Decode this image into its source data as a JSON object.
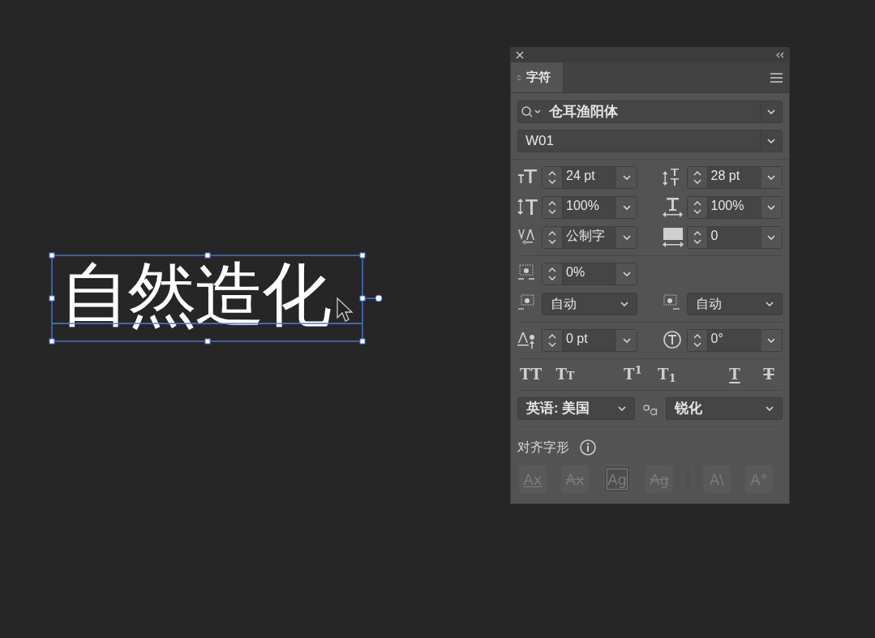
{
  "canvas": {
    "text": "自然造化"
  },
  "panel": {
    "tabs": [
      {
        "label": "字符",
        "selected": true
      }
    ],
    "font_family": "仓耳渔阳体",
    "font_style": "W01",
    "groups": [
      [
        [
          {
            "kind": "spin",
            "value": "24 pt"
          },
          {
            "kind": "spin",
            "value": "28 pt"
          }
        ],
        [
          {
            "kind": "spin",
            "value": "100%"
          },
          {
            "kind": "spin",
            "value": "100%"
          }
        ],
        [
          {
            "kind": "spin",
            "value": "公制字"
          },
          {
            "kind": "spin",
            "value": "0"
          }
        ]
      ],
      [
        [
          {
            "kind": "spin",
            "value": "0%"
          }
        ],
        [
          {
            "kind": "dropdown",
            "value": "自动"
          },
          {
            "kind": "dropdown",
            "value": "自动"
          }
        ]
      ],
      [
        [
          {
            "kind": "spin",
            "value": "0 pt"
          },
          {
            "kind": "spin",
            "value": "0°"
          }
        ]
      ]
    ],
    "style_buttons": [
      {
        "kind": "caps",
        "label": "TT"
      },
      {
        "kind": "smallcaps",
        "label": "TT"
      },
      {
        "kind": "super",
        "label": "T$^{1}$"
      },
      {
        "kind": "sub",
        "label": "T$_{1}$"
      },
      {
        "kind": "underline",
        "label": "T"
      },
      {
        "kind": "strike",
        "label": "T"
      }
    ],
    "language": "英语: 美国",
    "antialias": "锐化",
    "glyph_section": "对齐字形",
    "glyph_buttons": [
      {
        "kind": "baseline",
        "label": "Ax",
        "selected": false
      },
      {
        "kind": "strike",
        "label": "Ax",
        "selected": false
      },
      {
        "kind": "box",
        "label": "Ag",
        "selected": true
      },
      {
        "kind": "strike",
        "label": "Ag",
        "selected": false
      },
      {
        "kind": "plain",
        "label": "A\\",
        "selected": false
      },
      {
        "kind": "plain",
        "label": "A°",
        "selected": false
      }
    ]
  }
}
